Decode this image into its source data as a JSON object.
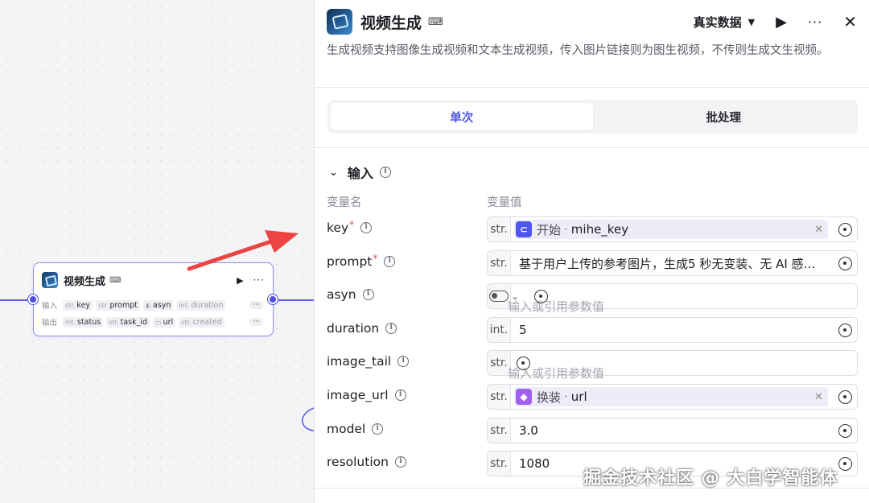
{
  "canvas": {
    "node": {
      "title": "视频生成",
      "inputs_label": "输入",
      "outputs_label": "输出",
      "inputs": [
        {
          "type": "str.",
          "name": "key"
        },
        {
          "type": "str.",
          "name": "prompt"
        },
        {
          "type": "toggle",
          "name": "asyn"
        },
        {
          "type": "int.",
          "name": "duration"
        }
      ],
      "outputs": [
        {
          "type": "int.",
          "name": "status"
        },
        {
          "type": "str.",
          "name": "task_id"
        },
        {
          "type": "folder",
          "name": "url"
        },
        {
          "type": "str.",
          "name": "created"
        }
      ],
      "more_label": "···"
    }
  },
  "panel": {
    "title": "视频生成",
    "data_mode": "真实数据",
    "description": "生成视频支持图像生成视频和文本生成视频，传入图片链接则为图生视频，不传则生成文生视频。",
    "tabs": [
      {
        "label": "单次",
        "active": true
      },
      {
        "label": "批处理",
        "active": false
      }
    ],
    "section_title": "输入",
    "col_name": "变量名",
    "col_value": "变量值",
    "params": [
      {
        "name": "key",
        "required": true,
        "type": "str.",
        "mode": "ref",
        "ref_node": "开始",
        "ref_var": "mihe_key",
        "ref_icon": "start-icon",
        "ref_color": "#4e55f0"
      },
      {
        "name": "prompt",
        "required": true,
        "type": "str.",
        "mode": "value",
        "value": "基于用户上传的参考图片，生成5 秒无变装、无 AI 感…"
      },
      {
        "name": "asyn",
        "required": false,
        "type": "toggle",
        "mode": "placeholder",
        "placeholder": "输入或引用参数值"
      },
      {
        "name": "duration",
        "required": false,
        "type": "int.",
        "mode": "value",
        "value": "5"
      },
      {
        "name": "image_tail",
        "required": false,
        "type": "str.",
        "mode": "placeholder",
        "placeholder": "输入或引用参数值"
      },
      {
        "name": "image_url",
        "required": false,
        "type": "str.",
        "mode": "ref",
        "ref_node": "换装",
        "ref_var": "url",
        "ref_icon": "cube-icon",
        "ref_color": "#a15ef0"
      },
      {
        "name": "model",
        "required": false,
        "type": "str.",
        "mode": "value",
        "value": "3.0"
      },
      {
        "name": "resolution",
        "required": false,
        "type": "str.",
        "mode": "value",
        "value": "1080"
      }
    ],
    "ref_separator": "·"
  },
  "watermark": "掘金技术社区 @ 大白学智能体",
  "colors": {
    "accent": "#4d53e8",
    "port": "#4e4fe8",
    "arrow": "#ee4343"
  }
}
